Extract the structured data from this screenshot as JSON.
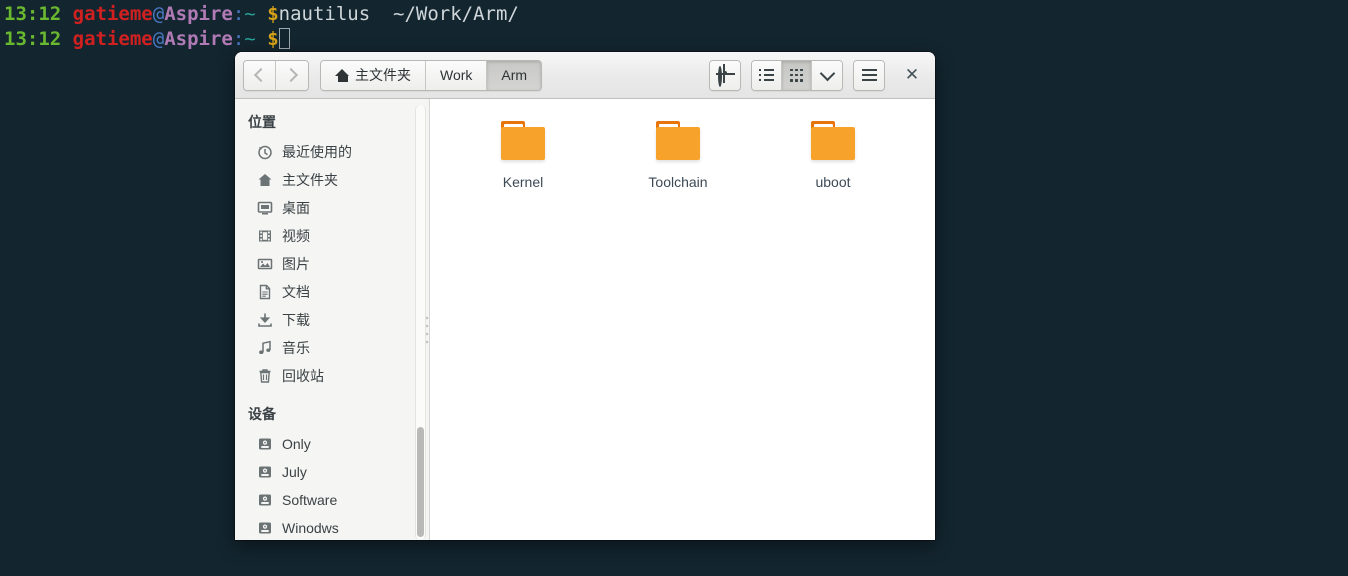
{
  "terminal": {
    "background_color": "#13252f",
    "lines": [
      {
        "time": "13:12",
        "user": "gatieme",
        "at": "@",
        "host": "Aspire",
        "colon": ":",
        "tilde": "~",
        "dollar": "$",
        "command": "nautilus",
        "argument": "~/Work/Arm/"
      },
      {
        "time": "13:12",
        "user": "gatieme",
        "at": "@",
        "host": "Aspire",
        "colon": ":",
        "tilde": "~",
        "dollar": "$",
        "command": "",
        "argument": ""
      }
    ],
    "colors": {
      "time": "#6ab82f",
      "user": "#d02020",
      "host": "#b07ab5",
      "dollar": "#d4a017",
      "text": "#cfd6d9"
    }
  },
  "window": {
    "nav": {
      "back_label": "‹",
      "forward_label": "›"
    },
    "breadcrumb": [
      {
        "label": "主文件夹",
        "icon": "home-icon",
        "active": false
      },
      {
        "label": "Work",
        "icon": "",
        "active": false
      },
      {
        "label": "Arm",
        "icon": "",
        "active": true
      }
    ],
    "toolbar": {
      "location_label": "location-icon",
      "list_view_label": "list-view-icon",
      "grid_view_label": "grid-view-icon",
      "view_options_label": "chevron-down-icon",
      "menu_label": "hamburger-menu-icon",
      "close_label": "✕",
      "active_view": "grid"
    }
  },
  "sidebar": {
    "places_header": "位置",
    "places": [
      {
        "label": "最近使用的",
        "icon": "clock-icon"
      },
      {
        "label": "主文件夹",
        "icon": "home-icon"
      },
      {
        "label": "桌面",
        "icon": "desktop-icon"
      },
      {
        "label": "视频",
        "icon": "video-icon"
      },
      {
        "label": "图片",
        "icon": "picture-icon"
      },
      {
        "label": "文档",
        "icon": "document-icon"
      },
      {
        "label": "下载",
        "icon": "download-icon"
      },
      {
        "label": "音乐",
        "icon": "music-icon"
      },
      {
        "label": "回收站",
        "icon": "trash-icon"
      }
    ],
    "devices_header": "设备",
    "devices": [
      {
        "label": "Only",
        "icon": "drive-icon"
      },
      {
        "label": "July",
        "icon": "drive-icon"
      },
      {
        "label": "Software",
        "icon": "drive-icon"
      },
      {
        "label": "Winodws",
        "icon": "drive-icon"
      }
    ]
  },
  "content": {
    "files": [
      {
        "name": "Kernel",
        "type": "folder"
      },
      {
        "name": "Toolchain",
        "type": "folder"
      },
      {
        "name": "uboot",
        "type": "folder"
      }
    ]
  }
}
